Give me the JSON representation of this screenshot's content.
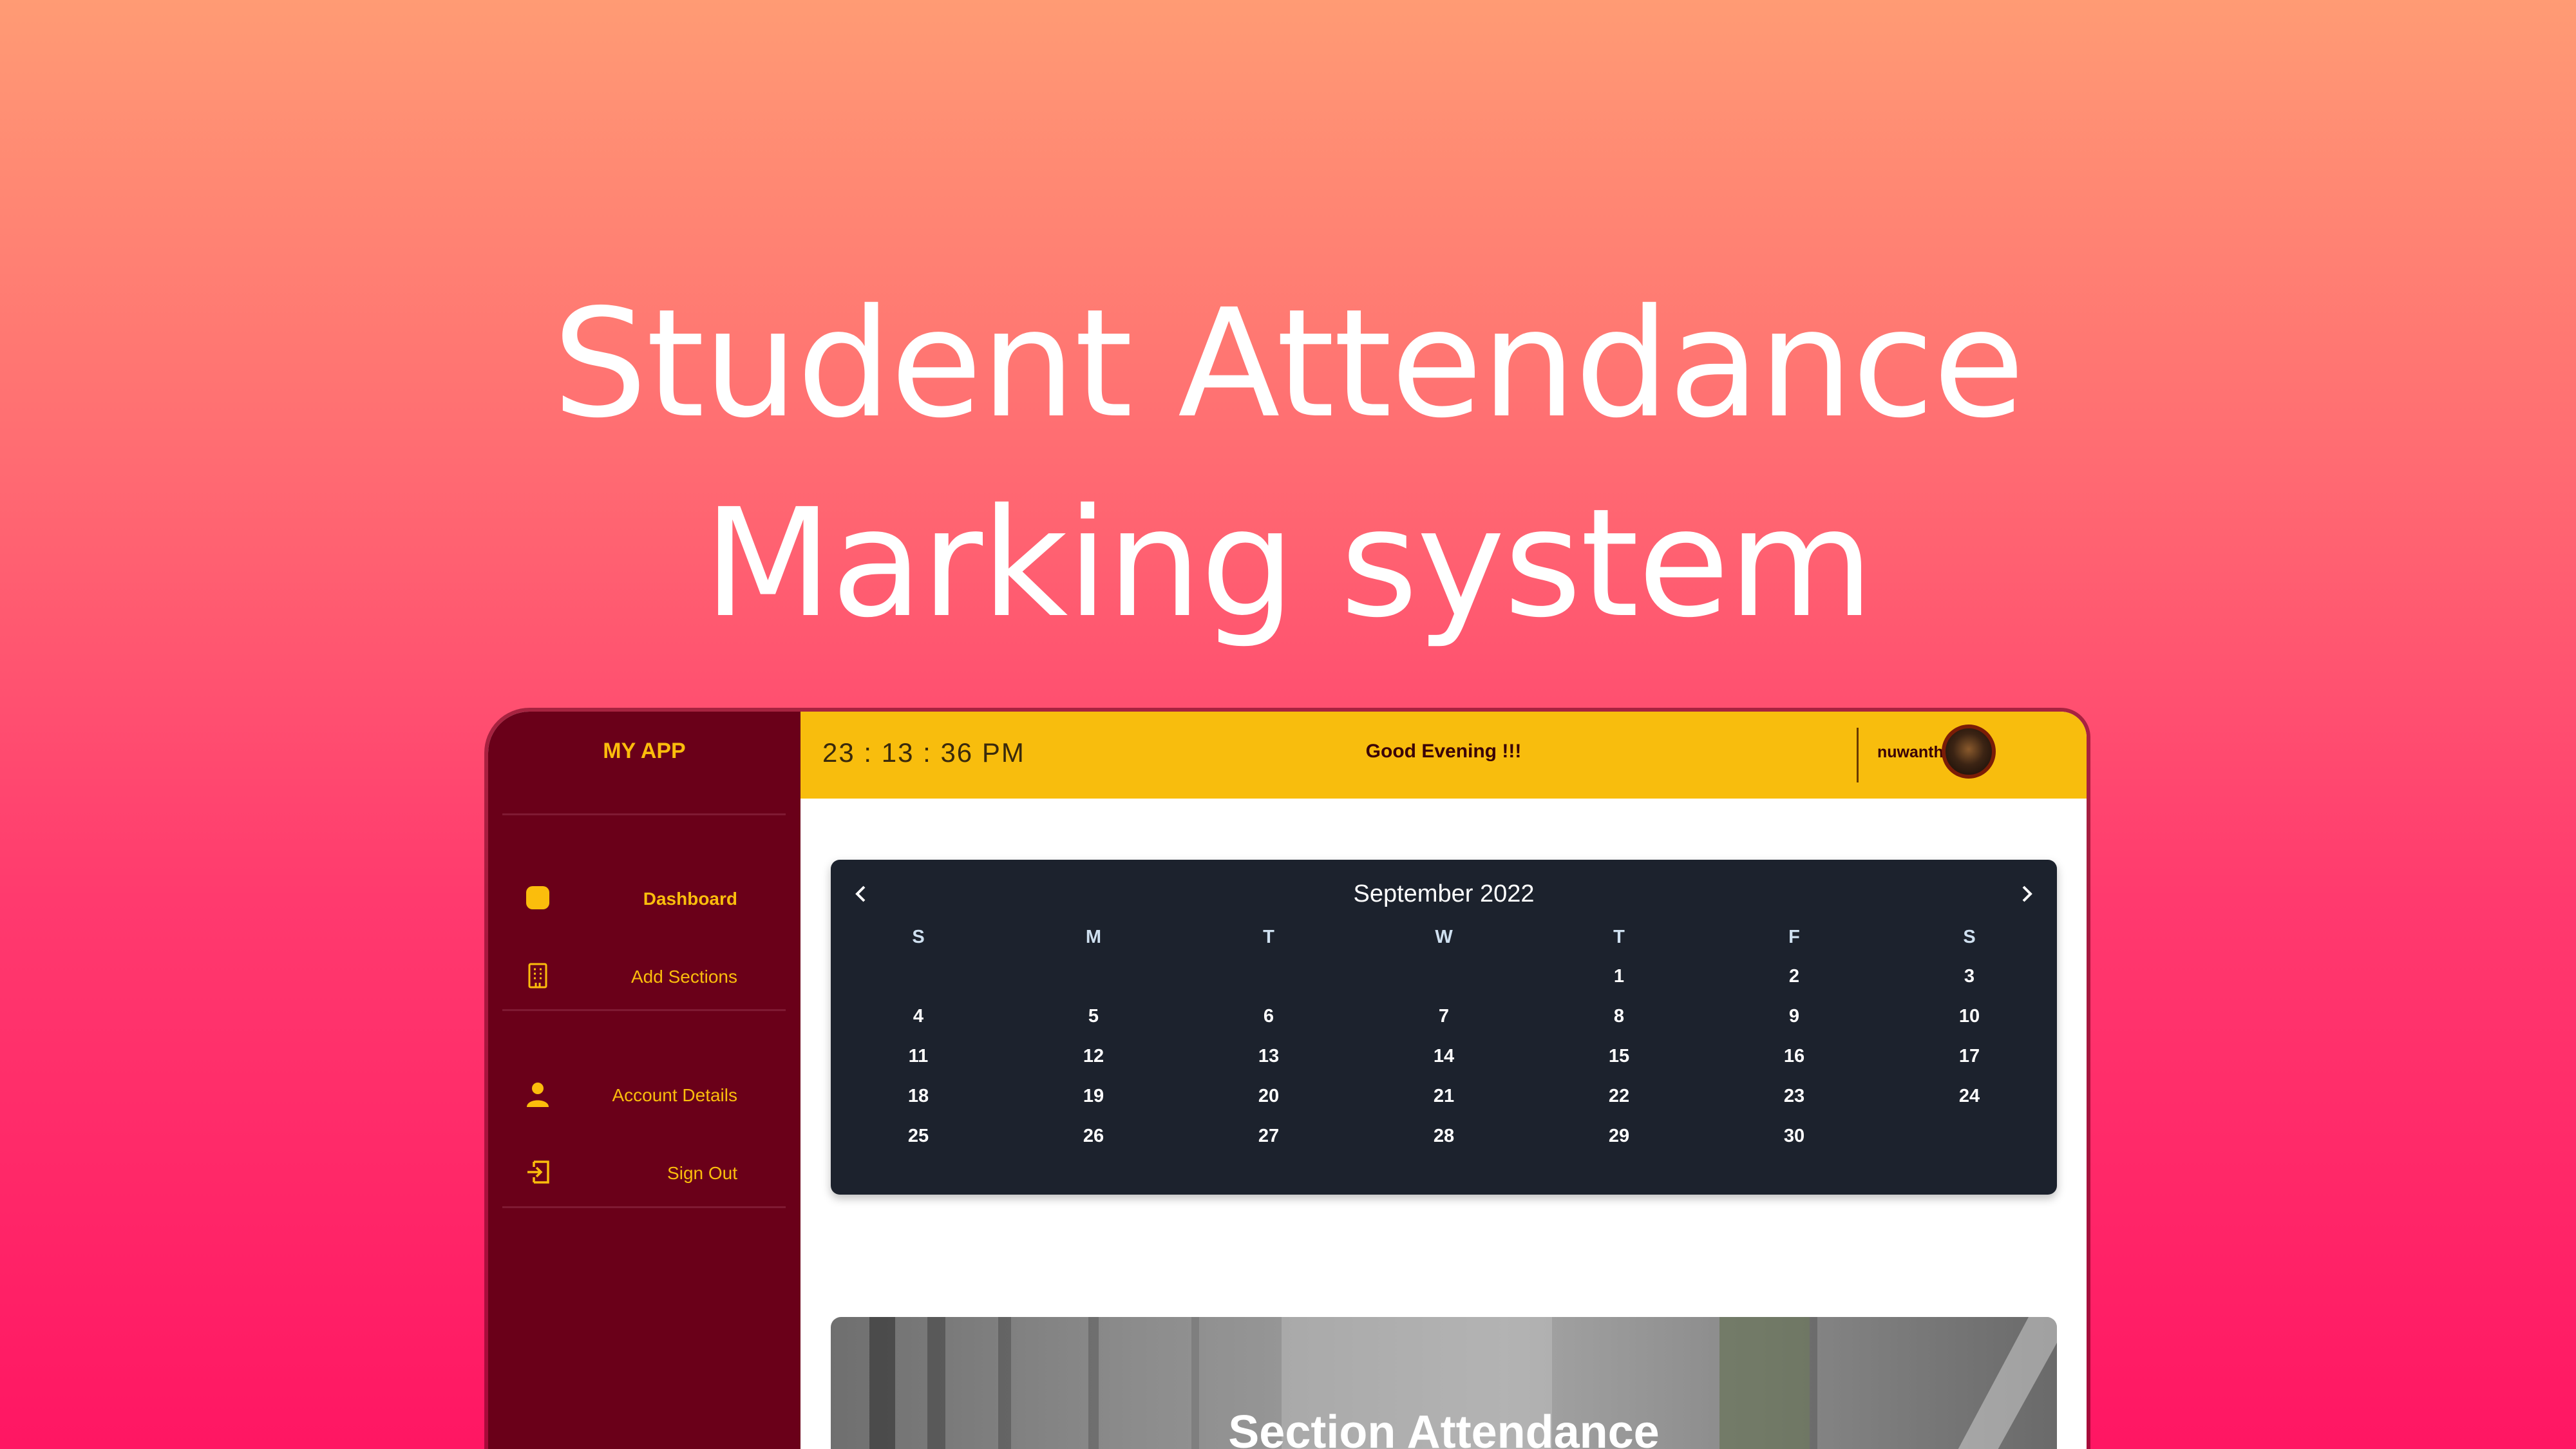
{
  "hero": {
    "line1": "Student Attendance",
    "line2": "Marking system"
  },
  "sidebar": {
    "brand": "MY APP",
    "items": [
      {
        "label": "Dashboard",
        "icon": "dashboard-icon",
        "active": true
      },
      {
        "label": "Add Sections",
        "icon": "building-icon",
        "active": false
      },
      {
        "label": "Account Details",
        "icon": "user-icon",
        "active": false
      },
      {
        "label": "Sign Out",
        "icon": "sign-out-icon",
        "active": false
      }
    ]
  },
  "topbar": {
    "clock": "23 :  13 :  36  PM",
    "greeting": "Good Evening !!!",
    "username": "nuwantha"
  },
  "calendar": {
    "month": "September 2022",
    "weekdays": [
      "S",
      "M",
      "T",
      "W",
      "T",
      "F",
      "S"
    ],
    "days": [
      "",
      "",
      "",
      "",
      "1",
      "2",
      "3",
      "4",
      "5",
      "6",
      "7",
      "8",
      "9",
      "10",
      "11",
      "12",
      "13",
      "14",
      "15",
      "16",
      "17",
      "18",
      "19",
      "20",
      "21",
      "22",
      "23",
      "24",
      "25",
      "26",
      "27",
      "28",
      "29",
      "30",
      ""
    ]
  },
  "section_card": {
    "title": "Section Attendance"
  },
  "colors": {
    "sidebar": "#6a0019",
    "accent": "#fbbd0c",
    "topbar": "#f8bd0d",
    "calendar": "#1c222d"
  }
}
